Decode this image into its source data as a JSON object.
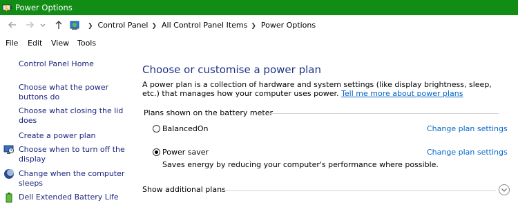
{
  "window": {
    "title": "Power Options"
  },
  "address_bar": {
    "breadcrumbs": [
      "Control Panel",
      "All Control Panel Items",
      "Power Options"
    ]
  },
  "menu": [
    "File",
    "Edit",
    "View",
    "Tools"
  ],
  "sidebar": {
    "home": "Control Panel Home",
    "items": [
      {
        "line1": "Choose what the power",
        "line2": "buttons do"
      },
      {
        "line1": "Choose what closing the lid",
        "line2": "does"
      },
      {
        "line1": "Create a power plan"
      },
      {
        "line1": "Choose when to turn off the",
        "line2": "display",
        "icon": "monitor-icon"
      },
      {
        "line1": "Change when the computer",
        "line2": "sleeps",
        "icon": "moon-icon"
      },
      {
        "line1": "Dell Extended Battery Life",
        "icon": "battery-icon"
      }
    ]
  },
  "main": {
    "heading": "Choose or customise a power plan",
    "description": "A power plan is a collection of hardware and system settings (like display brightness, sleep, etc.) that manages how your computer uses power.",
    "more_link": "Tell me more about power plans",
    "plans_section": "Plans shown on the battery meter",
    "plans": [
      {
        "name": "BalancedOn",
        "selected": false,
        "change_link": "Change plan settings"
      },
      {
        "name": "Power saver",
        "selected": true,
        "change_link": "Change plan settings",
        "description": "Saves energy by reducing your computer's performance where possible."
      }
    ],
    "additional_plans": "Show additional plans"
  },
  "colors": {
    "titlebar": "#118d15",
    "link": "#0066cc",
    "heading": "#1e3287",
    "sidebar_text": "#1a237e"
  }
}
